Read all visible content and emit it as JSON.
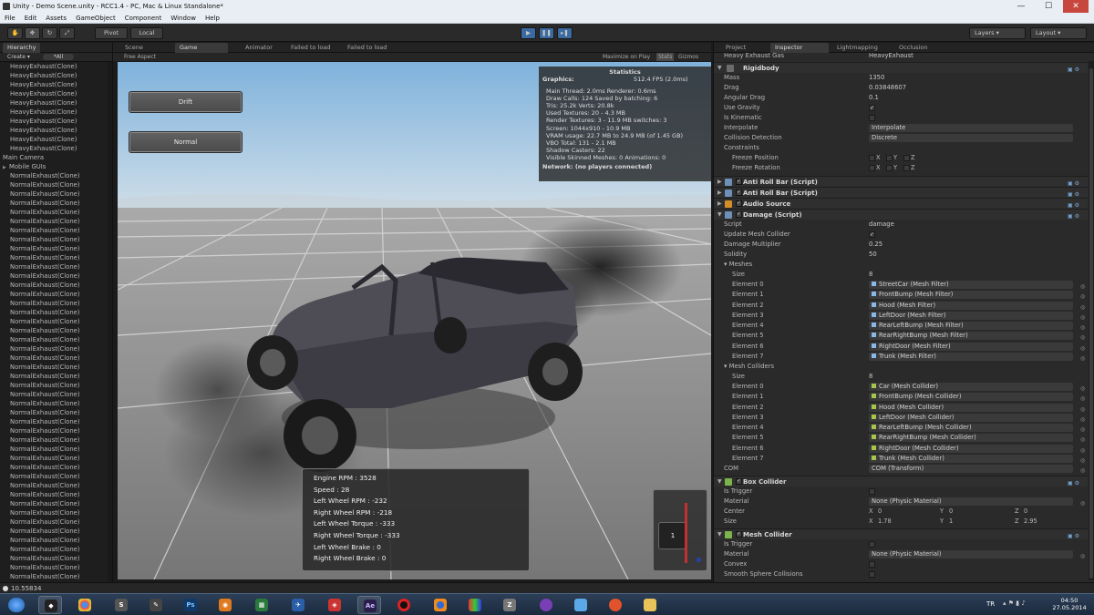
{
  "window": {
    "title": "Unity - Demo Scene.unity - RCC1.4 - PC, Mac & Linux Standalone*",
    "minimize": "—",
    "maximize": "☐",
    "close": "✕"
  },
  "menu": [
    "File",
    "Edit",
    "Assets",
    "GameObject",
    "Component",
    "Window",
    "Help"
  ],
  "toolbar": {
    "pivot": "Pivot",
    "local": "Local",
    "layers": "Layers",
    "layout": "Layout"
  },
  "hierarchy": {
    "tab": "Hierarchy",
    "create": "Create",
    "search": "*All",
    "rows_top": [
      "HeavyExhaust(Clone)",
      "HeavyExhaust(Clone)",
      "HeavyExhaust(Clone)",
      "HeavyExhaust(Clone)",
      "HeavyExhaust(Clone)",
      "HeavyExhaust(Clone)",
      "HeavyExhaust(Clone)",
      "HeavyExhaust(Clone)",
      "HeavyExhaust(Clone)",
      "HeavyExhaust(Clone)"
    ],
    "main_camera": "Main Camera",
    "mobile_guis": "Mobile GUIs",
    "rows_normal": [
      "NormalExhaust(Clone)",
      "NormalExhaust(Clone)",
      "NormalExhaust(Clone)",
      "NormalExhaust(Clone)",
      "NormalExhaust(Clone)",
      "NormalExhaust(Clone)",
      "NormalExhaust(Clone)",
      "NormalExhaust(Clone)",
      "NormalExhaust(Clone)",
      "NormalExhaust(Clone)",
      "NormalExhaust(Clone)",
      "NormalExhaust(Clone)",
      "NormalExhaust(Clone)",
      "NormalExhaust(Clone)",
      "NormalExhaust(Clone)",
      "NormalExhaust(Clone)",
      "NormalExhaust(Clone)",
      "NormalExhaust(Clone)",
      "NormalExhaust(Clone)",
      "NormalExhaust(Clone)",
      "NormalExhaust(Clone)",
      "NormalExhaust(Clone)",
      "NormalExhaust(Clone)",
      "NormalExhaust(Clone)",
      "NormalExhaust(Clone)",
      "NormalExhaust(Clone)",
      "NormalExhaust(Clone)",
      "NormalExhaust(Clone)",
      "NormalExhaust(Clone)",
      "NormalExhaust(Clone)",
      "NormalExhaust(Clone)",
      "NormalExhaust(Clone)",
      "NormalExhaust(Clone)",
      "NormalExhaust(Clone)",
      "NormalExhaust(Clone)",
      "NormalExhaust(Clone)",
      "NormalExhaust(Clone)",
      "NormalExhaust(Clone)",
      "NormalExhaust(Clone)",
      "NormalExhaust(Clone)",
      "NormalExhaust(Clone)",
      "NormalExhaust(Clone)",
      "NormalExhaust(Clone)",
      "NormalExhaust(Clone)",
      "NormalExhaust(Clone)",
      "NormalExhaust(Clone)",
      "NormalExhaust(Clone)"
    ]
  },
  "views": {
    "scene": "Scene",
    "game": "Game",
    "animator": "Animator",
    "failed1": "Failed to load",
    "failed2": "Failed to load",
    "free_aspect": "Free Aspect",
    "maximize": "Maximize on Play",
    "stats": "Stats",
    "gizmos": "Gizmos"
  },
  "game": {
    "drift": "Drift",
    "normal": "Normal",
    "gear": "1",
    "stats": {
      "title": "Statistics",
      "graphics": "Graphics:",
      "fps": "512.4 FPS (2.0ms)",
      "lines": [
        "Main Thread: 2.0ms  Renderer: 0.6ms",
        "Draw Calls: 124   Saved by batching: 6",
        "Tris: 25.2k   Verts: 20.8k",
        "Used Textures: 20 - 4.3 MB",
        "Render Textures: 3 - 11.9 MB   switches: 3",
        "Screen: 1044x910 - 10.9 MB",
        "VRAM usage: 22.7 MB to 24.9 MB (of 1.45 GB)",
        "VBO Total: 131 - 2.1 MB",
        "Shadow Casters: 22",
        "Visible Skinned Meshes: 0    Animations: 0"
      ],
      "network": "Network: (no players connected)"
    },
    "telemetry": [
      "Engine RPM : 3528",
      "Speed : 28",
      "Left Wheel RPM : -232",
      "Right Wheel RPM : -218",
      "Left Wheel Torque : -333",
      "Right Wheel Torque : -333",
      "Left Wheel Brake : 0",
      "Right Wheel Brake : 0"
    ]
  },
  "inspector": {
    "tabs": {
      "project": "Project",
      "inspector": "Inspector",
      "lightmapping": "Lightmapping",
      "occlusion": "Occlusion"
    },
    "header_prev": "Heavy Exhaust Gas",
    "header_prev_val": "HeavyExhaust",
    "rigidbody": {
      "title": "Rigidbody",
      "mass_l": "Mass",
      "mass": "1350",
      "drag_l": "Drag",
      "drag": "0.03848607",
      "adrag_l": "Angular Drag",
      "adrag": "0.1",
      "grav_l": "Use Gravity",
      "kin_l": "Is Kinematic",
      "interp_l": "Interpolate",
      "interp": "Interpolate",
      "coll_l": "Collision Detection",
      "coll": "Discrete",
      "cons_l": "Constraints",
      "fpos_l": "Freeze Position",
      "frot_l": "Freeze Rotation",
      "x": "X",
      "y": "Y",
      "z": "Z"
    },
    "anti1": "Anti Roll Bar (Script)",
    "anti2": "Anti Roll Bar (Script)",
    "audio": "Audio Source",
    "damage": {
      "title": "Damage (Script)",
      "script_l": "Script",
      "script": "damage",
      "umc_l": "Update Mesh Collider",
      "mult_l": "Damage Multiplier",
      "mult": "0.25",
      "sol_l": "Solidity",
      "sol": "50",
      "meshes_l": "Meshes",
      "size_l": "Size",
      "size": "8",
      "meshes": [
        [
          "Element 0",
          "StreetCar (Mesh Filter)"
        ],
        [
          "Element 1",
          "FrontBump (Mesh Filter)"
        ],
        [
          "Element 2",
          "Hood (Mesh Filter)"
        ],
        [
          "Element 3",
          "LeftDoor (Mesh Filter)"
        ],
        [
          "Element 4",
          "RearLeftBump (Mesh Filter)"
        ],
        [
          "Element 5",
          "RearRightBump (Mesh Filter)"
        ],
        [
          "Element 6",
          "RightDoor (Mesh Filter)"
        ],
        [
          "Element 7",
          "Trunk (Mesh Filter)"
        ]
      ],
      "mc_l": "Mesh Colliders",
      "mc_size": "8",
      "colliders": [
        [
          "Element 0",
          "Car (Mesh Collider)"
        ],
        [
          "Element 1",
          "FrontBump (Mesh Collider)"
        ],
        [
          "Element 2",
          "Hood (Mesh Collider)"
        ],
        [
          "Element 3",
          "LeftDoor (Mesh Collider)"
        ],
        [
          "Element 4",
          "RearLeftBump (Mesh Collider)"
        ],
        [
          "Element 5",
          "RearRightBump (Mesh Collider)"
        ],
        [
          "Element 6",
          "RightDoor (Mesh Collider)"
        ],
        [
          "Element 7",
          "Trunk (Mesh Collider)"
        ]
      ],
      "com_l": "COM",
      "com": "COM (Transform)"
    },
    "box": {
      "title": "Box Collider",
      "trig_l": "Is Trigger",
      "mat_l": "Material",
      "mat": "None (Physic Material)",
      "center_l": "Center",
      "cx": "0",
      "cy": "0",
      "cz": "0",
      "size_l": "Size",
      "sx": "1.78",
      "sy": "1",
      "sz": "2.95"
    },
    "meshcol": {
      "title": "Mesh Collider",
      "trig_l": "Is Trigger",
      "mat_l": "Material",
      "mat": "None (Physic Material)",
      "convex_l": "Convex",
      "smooth_l": "Smooth Sphere Collisions"
    }
  },
  "status": "10.55834",
  "taskbar": {
    "lang": "TR",
    "time": "04:50",
    "date": "27.05.2014"
  }
}
